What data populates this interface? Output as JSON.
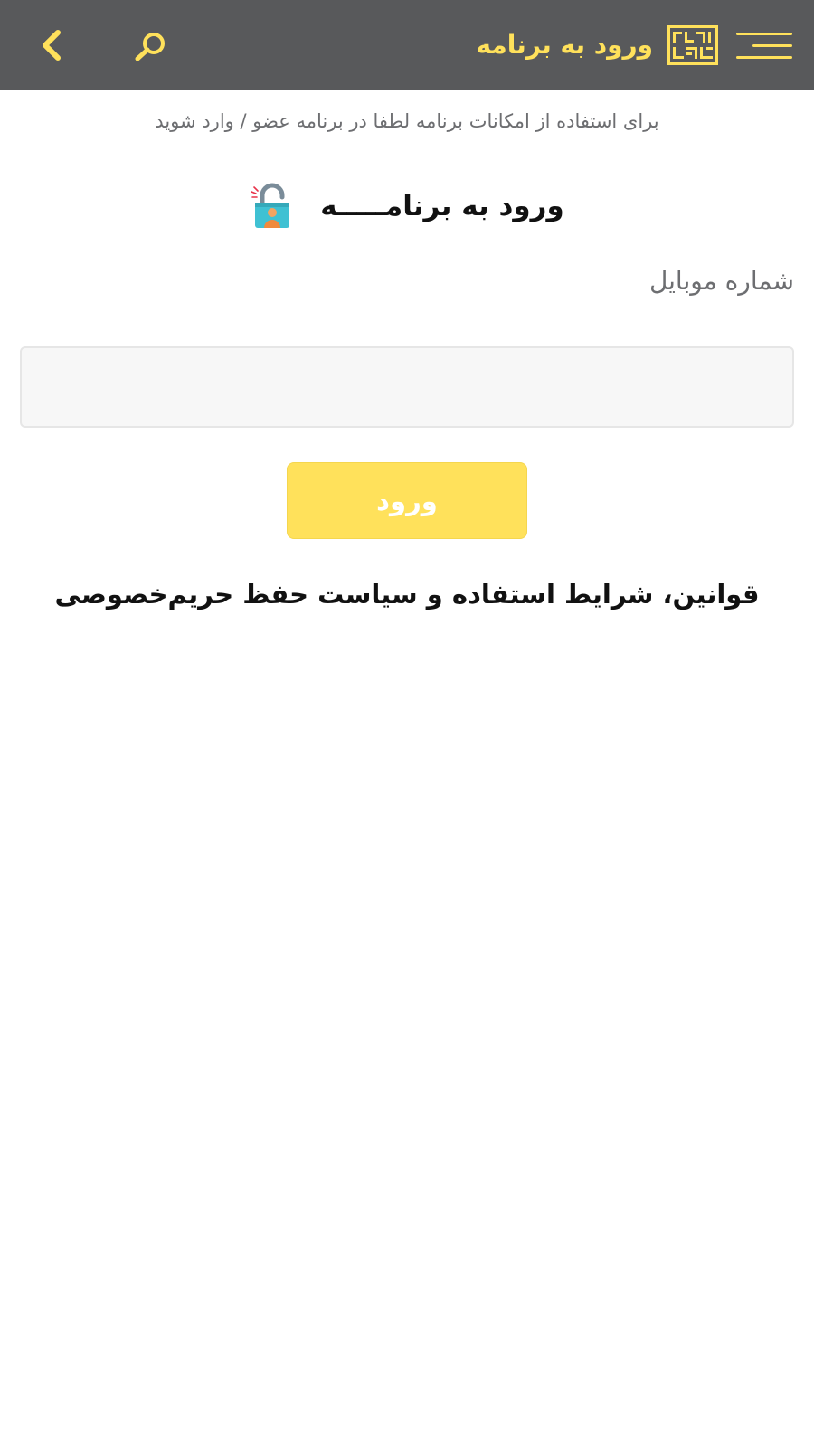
{
  "header": {
    "title": "ورود به برنامه",
    "logo_icon": "brand-logo",
    "menu_icon": "hamburger-icon",
    "search_icon": "search-icon",
    "back_icon": "chevron-left-icon"
  },
  "main": {
    "subtitle": "برای استفاده از امکانات برنامه لطفا در برنامه عضو / وارد شوید",
    "login_heading": "ورود به برنامـــــه",
    "login_icon": "lock-user-icon",
    "mobile_label": "شماره موبایل",
    "mobile_value": "",
    "login_button": "ورود",
    "terms_link": "قوانین، شرایط استفاده و سیاست حفظ حریم‌خصوصی"
  },
  "colors": {
    "header_bg": "#58595b",
    "accent": "#ffe15b",
    "label_gray": "#6d6e71",
    "input_bg": "#f7f7f7"
  }
}
